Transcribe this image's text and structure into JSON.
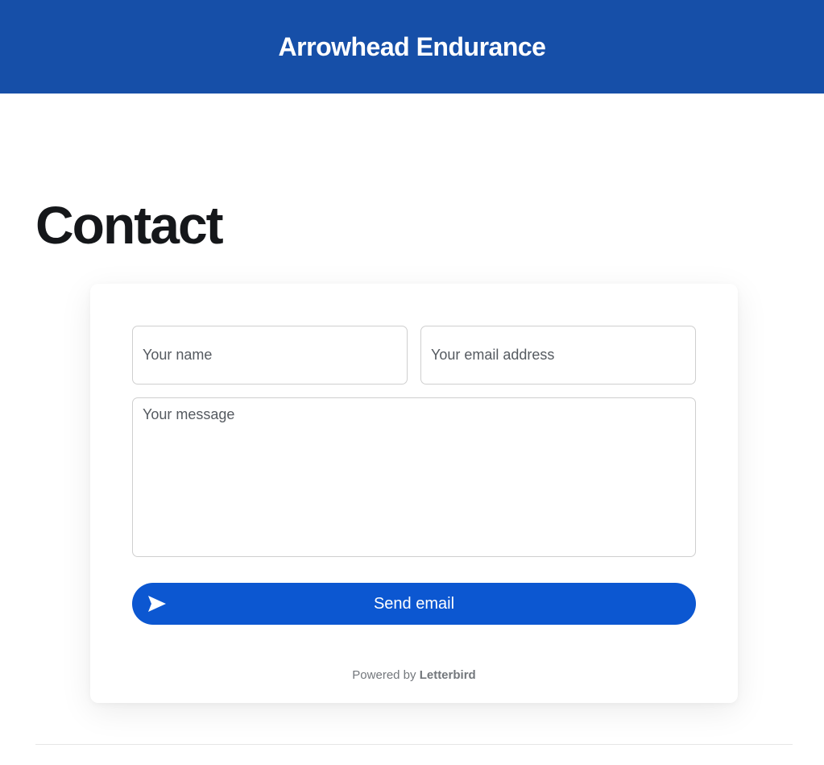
{
  "header": {
    "site_title": "Arrowhead Endurance",
    "background": "#164fa8"
  },
  "main": {
    "page_title": "Contact"
  },
  "form": {
    "name_placeholder": "Your name",
    "name_value": "",
    "email_placeholder": "Your email address",
    "email_value": "",
    "message_placeholder": "Your message",
    "message_value": "",
    "send_label": "Send email",
    "send_icon": "paper-plane-icon",
    "button_color": "#0c57d1"
  },
  "footer": {
    "powered_prefix": "Powered by",
    "powered_brand": "Letterbird"
  }
}
